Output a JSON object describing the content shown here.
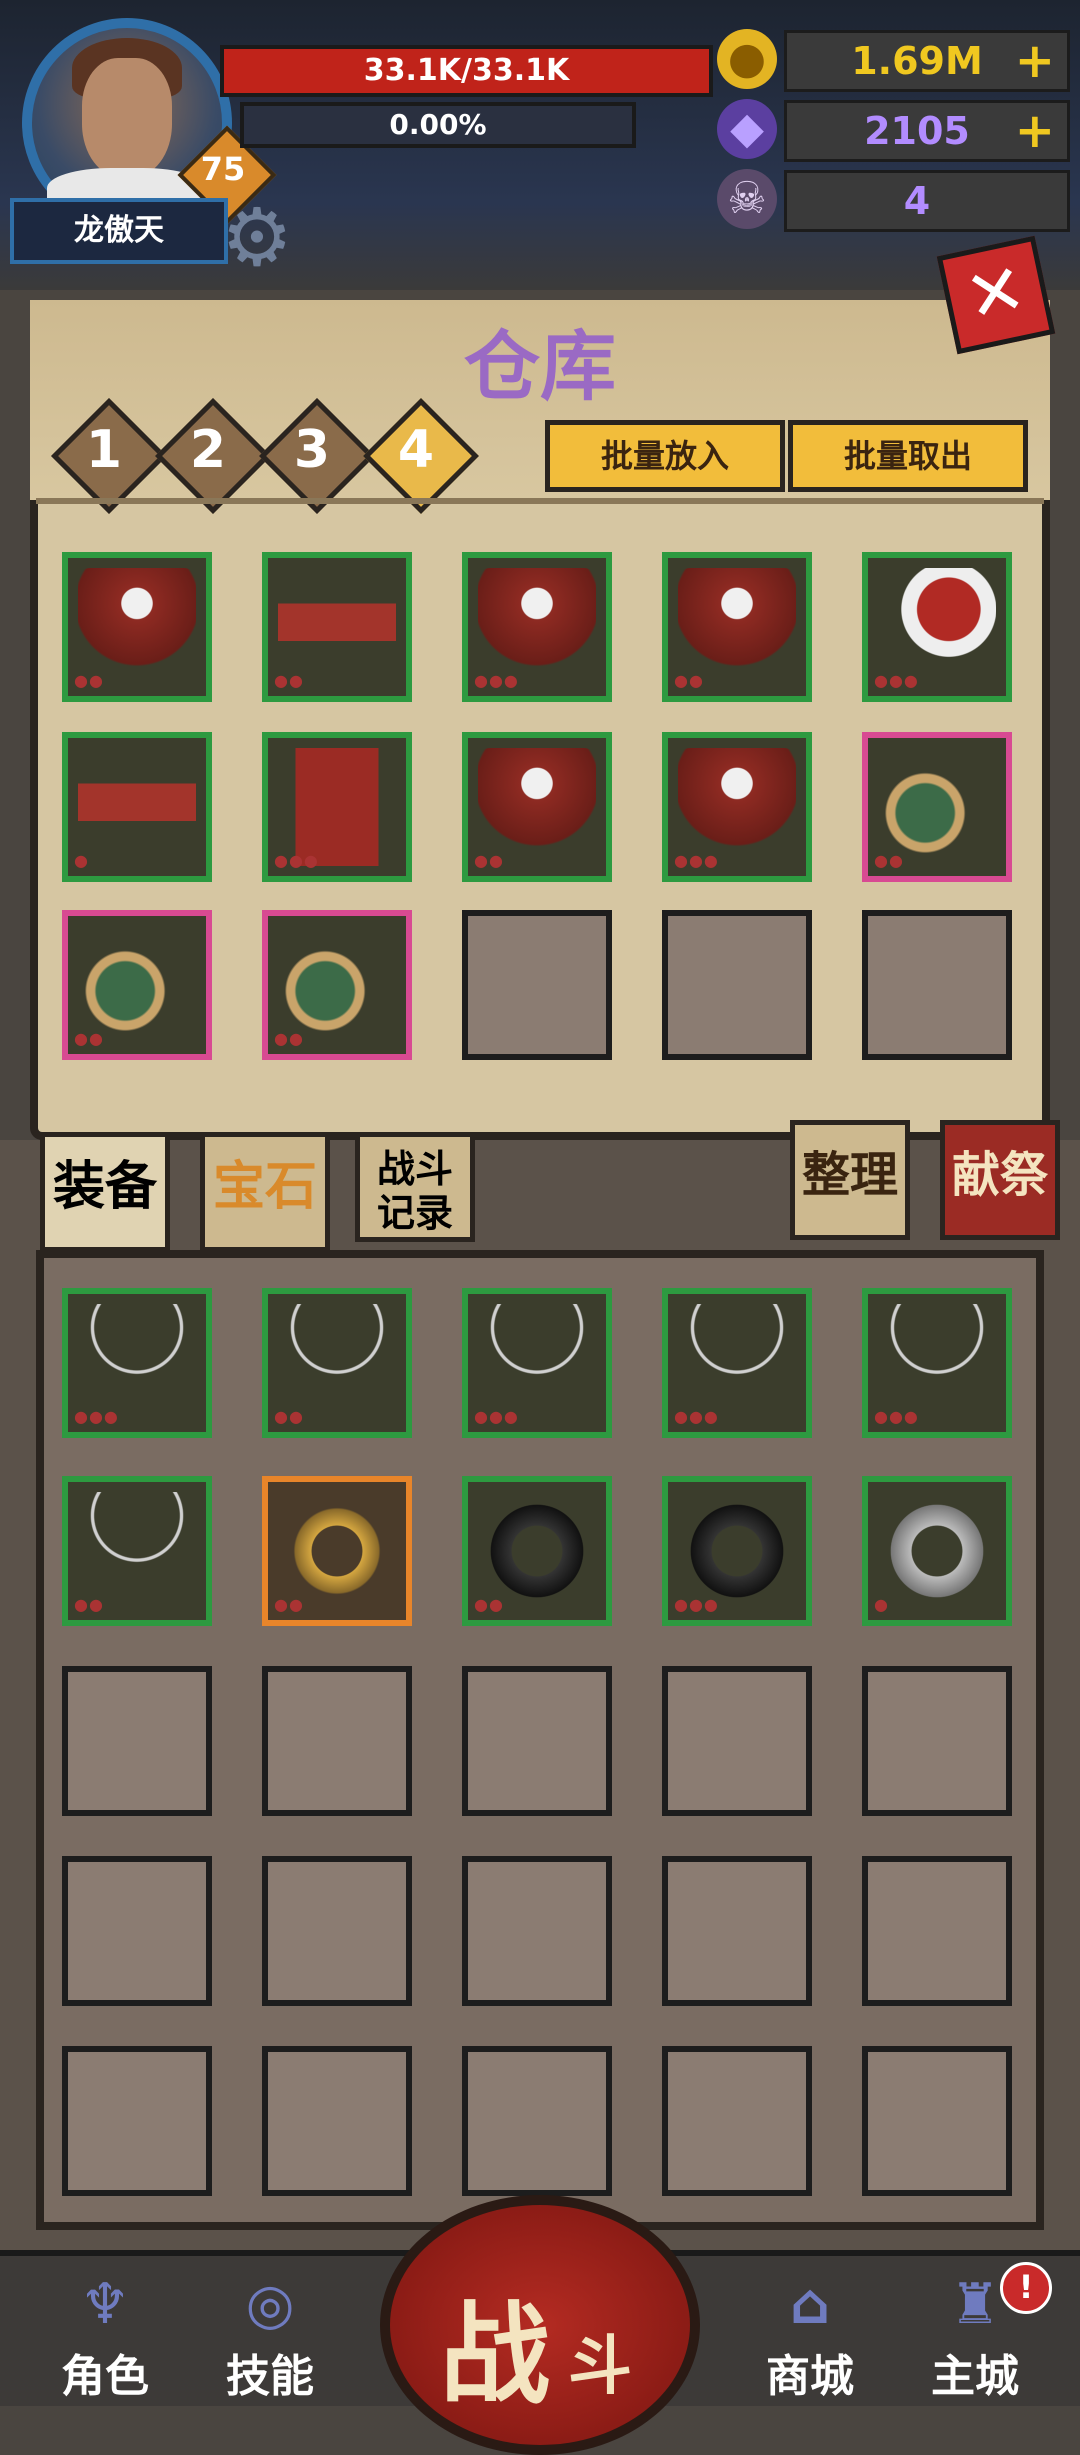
{
  "player": {
    "name": "龙傲天",
    "level": "75",
    "hp": "33.1K/33.1K",
    "xp": "0.00%"
  },
  "resources": {
    "gold": "1.69M",
    "crystal": "2105",
    "skull": "4"
  },
  "warehouse": {
    "title": "仓库",
    "tabs": [
      "1",
      "2",
      "3",
      "4"
    ],
    "active_tab": "4",
    "batch_put": "批量放入",
    "batch_take": "批量取出"
  },
  "side_tabs": {
    "equipment": "装备",
    "gems": "宝石",
    "battle_log_1": "战斗",
    "battle_log_2": "记录",
    "sort": "整理",
    "sacrifice": "献祭"
  },
  "nav": {
    "role": "角色",
    "skills": "技能",
    "fight_1": "战",
    "fight_2": "斗",
    "shop": "商城",
    "city": "主城",
    "alert": "!"
  },
  "colors": {
    "accent_green": "#2d9a40",
    "accent_pink": "#d84a92",
    "accent_orange": "#e8852a",
    "hp_red": "#c0231a"
  },
  "icons": {
    "gold": "gold-coin-icon",
    "crystal": "crystal-icon",
    "skull": "ram-skull-icon",
    "settings": "gear-icon",
    "close": "close-icon"
  }
}
